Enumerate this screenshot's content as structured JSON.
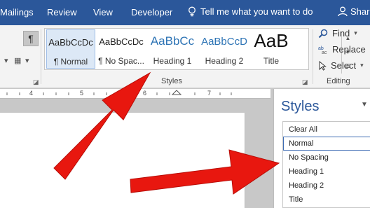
{
  "ribbon_tabs": {
    "mailings": "Mailings",
    "review": "Review",
    "view": "View",
    "developer": "Developer"
  },
  "tell_me": "Tell me what you want to do",
  "share": "Share",
  "styles_gallery": {
    "items": [
      {
        "sample": "AaBbCcDc",
        "name": "¶ Normal"
      },
      {
        "sample": "AaBbCcDc",
        "name": "¶ No Spac..."
      },
      {
        "sample": "AaBbCc",
        "name": "Heading 1"
      },
      {
        "sample": "AaBbCcD",
        "name": "Heading 2"
      },
      {
        "sample": "AaB",
        "name": "Title"
      }
    ],
    "group_label": "Styles"
  },
  "editing": {
    "find": "Find",
    "replace": "Replace",
    "select": "Select",
    "group_label": "Editing"
  },
  "paragraph_mark": "¶",
  "ruler": [
    "4",
    "5",
    "6",
    "7"
  ],
  "styles_pane": {
    "title": "Styles",
    "items": [
      "Clear All",
      "Normal",
      "No Spacing",
      "Heading 1",
      "Heading 2",
      "Title"
    ]
  },
  "colors": {
    "ribbon_blue": "#2b579a",
    "arrow_red": "#e8170f"
  }
}
